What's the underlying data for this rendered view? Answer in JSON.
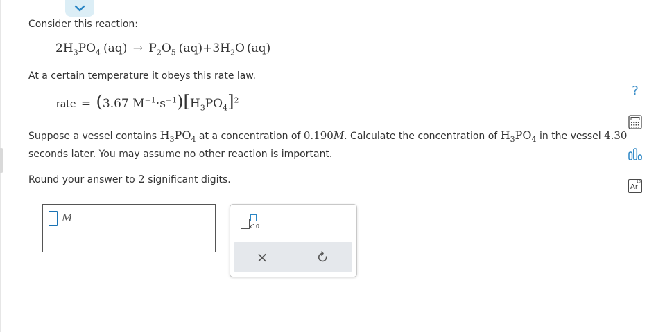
{
  "intro": "Consider this reaction:",
  "reaction": {
    "coef1": "2",
    "r_H": "H",
    "r_H_sub": "3",
    "r_P": "PO",
    "r_P_sub": "4",
    "r_state": "(aq)",
    "arrow": "→",
    "p1_P": "P",
    "p1_P_sub": "2",
    "p1_O": "O",
    "p1_O_sub": "5",
    "p1_state": "(aq)",
    "plus": "+",
    "coef2": "3",
    "p2_H": "H",
    "p2_H_sub": "2",
    "p2_O": "O",
    "p2_state": "(aq)"
  },
  "rate_law_intro": "At a certain temperature it obeys this rate law.",
  "rate_law": {
    "label": "rate",
    "equals": "=",
    "k_value": "3.67",
    "unit_M": "M",
    "unit_M_exp": "−1",
    "dot": "·",
    "unit_s": "s",
    "unit_s_exp": "−1",
    "conc_H": "H",
    "conc_H_sub": "3",
    "conc_P": "PO",
    "conc_P_sub": "4",
    "order": "2"
  },
  "question": {
    "p1": "Suppose a vessel contains ",
    "s1_H": "H",
    "s1_H_sub": "3",
    "s1_P": "PO",
    "s1_P_sub": "4",
    "p2": " at a concentration of ",
    "conc": "0.190",
    "conc_unit": "M",
    "p3": ". Calculate the concentration of ",
    "s2_H": "H",
    "s2_H_sub": "3",
    "s2_P": "PO",
    "s2_P_sub": "4",
    "p4": " in the vessel ",
    "time": "4.30",
    "line2": "seconds later. You may assume no other reaction is important."
  },
  "round": {
    "p1": "Round your answer to ",
    "digits": "2",
    "p2": " significant digits."
  },
  "answer": {
    "value": "",
    "unit": "M"
  },
  "keypad": {
    "x10_label": "x10",
    "clear_symbol": "×",
    "undo_symbol": "↺"
  },
  "colors": {
    "accent": "#2b86c5",
    "help": "#3d8fc9",
    "text": "#333333"
  },
  "icons": [
    "chevron-down-icon",
    "help-icon",
    "calculator-icon",
    "chart-icon",
    "periodic-table-icon"
  ],
  "periodic_table": {
    "number": "18",
    "symbol": "Ar"
  }
}
